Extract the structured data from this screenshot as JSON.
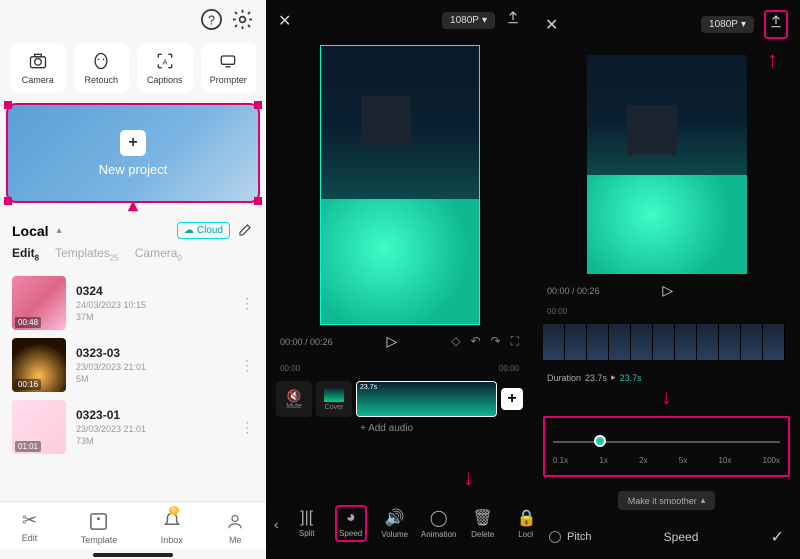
{
  "panel1": {
    "tools": [
      {
        "label": "Camera"
      },
      {
        "label": "Retouch"
      },
      {
        "label": "Captions"
      },
      {
        "label": "Prompter"
      }
    ],
    "new_project": "New project",
    "local_label": "Local",
    "cloud_label": "Cloud",
    "subtabs": [
      {
        "label": "Edit",
        "count": "8"
      },
      {
        "label": "Templates",
        "count": "25"
      },
      {
        "label": "Camera",
        "count": "0"
      }
    ],
    "projects": [
      {
        "name": "0324",
        "date": "24/03/2023 10:15",
        "size": "37M",
        "dur": "00:48"
      },
      {
        "name": "0323-03",
        "date": "23/03/2023 21:01",
        "size": "5M",
        "dur": "00:16"
      },
      {
        "name": "0323-01",
        "date": "23/03/2023 21:01",
        "size": "73M",
        "dur": "01:01"
      }
    ],
    "nav": [
      {
        "label": "Edit"
      },
      {
        "label": "Template"
      },
      {
        "label": "Inbox",
        "badge": "5"
      },
      {
        "label": "Me"
      }
    ]
  },
  "panel2": {
    "quality": "1080P",
    "time_current": "00:00",
    "time_total": "00:26",
    "tick1": "00:00",
    "tick2": "00:00",
    "clip_dur": "23.7s",
    "mute": "Mute",
    "cover": "Cover",
    "add_audio": "+ Add audio",
    "tools": [
      {
        "label": "Split"
      },
      {
        "label": "Speed"
      },
      {
        "label": "Volume"
      },
      {
        "label": "Animation"
      },
      {
        "label": "Delete"
      },
      {
        "label": "Lock"
      }
    ]
  },
  "panel3": {
    "quality": "1080P",
    "time_current": "00:00",
    "time_total": "00:26",
    "tick1": "00:00",
    "duration_label": "Duration",
    "duration_orig": "23.7s",
    "duration_arrow": "▸",
    "duration_new": "23.7s",
    "speed_stops": [
      "0.1x",
      "1x",
      "2x",
      "5x",
      "10x",
      "100x"
    ],
    "smoother": "Make it smoother",
    "pitch": "Pitch",
    "speed_title": "Speed"
  }
}
